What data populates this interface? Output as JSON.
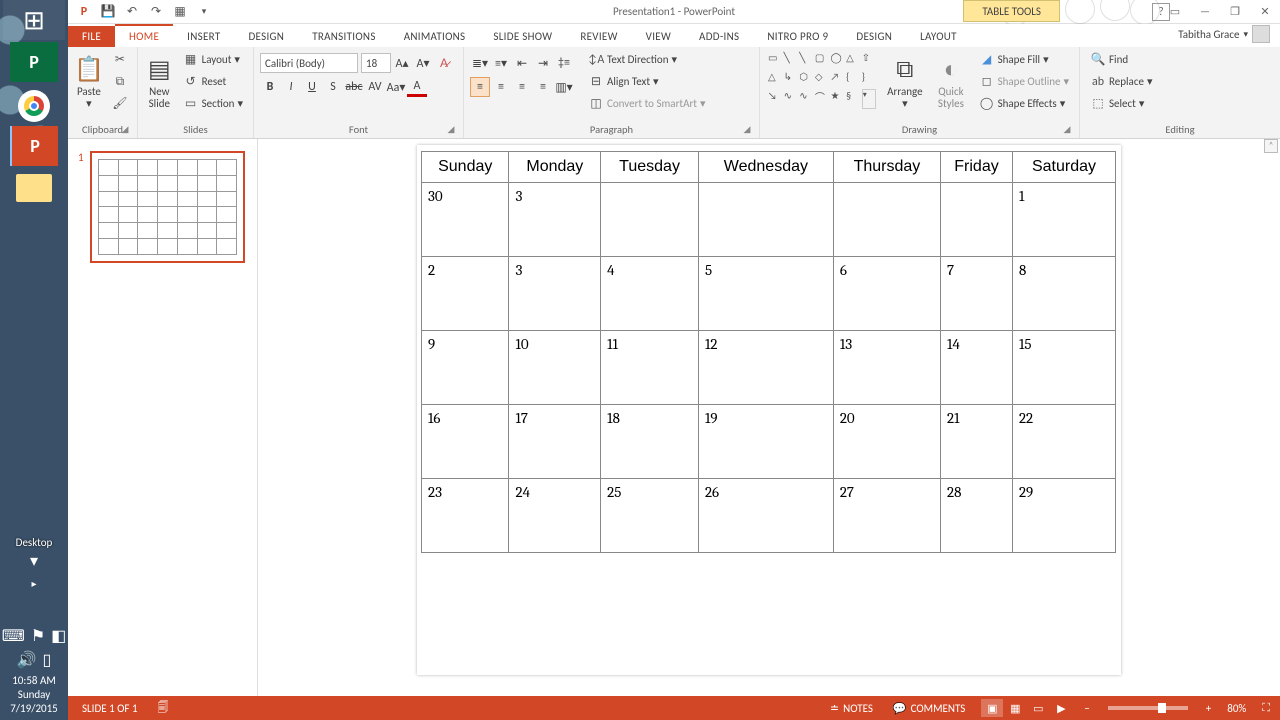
{
  "taskbar": {
    "desktop_label": "Desktop",
    "clock_time": "10:58 AM",
    "clock_day": "Sunday",
    "clock_date": "7/19/2015"
  },
  "title": "Presentation1 - PowerPoint",
  "contextual_tab": "TABLE TOOLS",
  "user": "Tabitha Grace",
  "tabs": {
    "file": "FILE",
    "home": "HOME",
    "insert": "INSERT",
    "design": "DESIGN",
    "transitions": "TRANSITIONS",
    "animations": "ANIMATIONS",
    "slideshow": "SLIDE SHOW",
    "review": "REVIEW",
    "view": "VIEW",
    "addins": "ADD-INS",
    "nitro": "NITRO PRO 9",
    "ctx_design": "DESIGN",
    "ctx_layout": "LAYOUT"
  },
  "ribbon": {
    "clipboard": {
      "label": "Clipboard",
      "paste": "Paste"
    },
    "slides": {
      "label": "Slides",
      "new": "New\nSlide",
      "layout": "Layout",
      "reset": "Reset",
      "section": "Section"
    },
    "font": {
      "label": "Font",
      "name": "Calibri (Body)",
      "size": "18"
    },
    "paragraph": {
      "label": "Paragraph",
      "textdir": "Text Direction",
      "align": "Align Text",
      "smartart": "Convert to SmartArt"
    },
    "drawing": {
      "label": "Drawing",
      "arrange": "Arrange",
      "quick": "Quick\nStyles",
      "fill": "Shape Fill",
      "outline": "Shape Outline",
      "effects": "Shape Effects"
    },
    "editing": {
      "label": "Editing",
      "find": "Find",
      "replace": "Replace",
      "select": "Select"
    }
  },
  "thumb_number": "1",
  "calendar": {
    "headers": [
      "Sunday",
      "Monday",
      "Tuesday",
      "Wednesday",
      "Thursday",
      "Friday",
      "Saturday"
    ],
    "rows": [
      [
        "30",
        "3",
        "",
        "",
        "",
        "",
        "1"
      ],
      [
        "2",
        "3",
        "4",
        "5",
        "6",
        "7",
        "8"
      ],
      [
        "9",
        "10",
        "11",
        "12",
        "13",
        "14",
        "15"
      ],
      [
        "16",
        "17",
        "18",
        "19",
        "20",
        "21",
        "22"
      ],
      [
        "23",
        "24",
        "25",
        "26",
        "27",
        "28",
        "29"
      ]
    ]
  },
  "status": {
    "slide": "SLIDE 1 OF 1",
    "notes": "NOTES",
    "comments": "COMMENTS",
    "zoom": "80%"
  }
}
